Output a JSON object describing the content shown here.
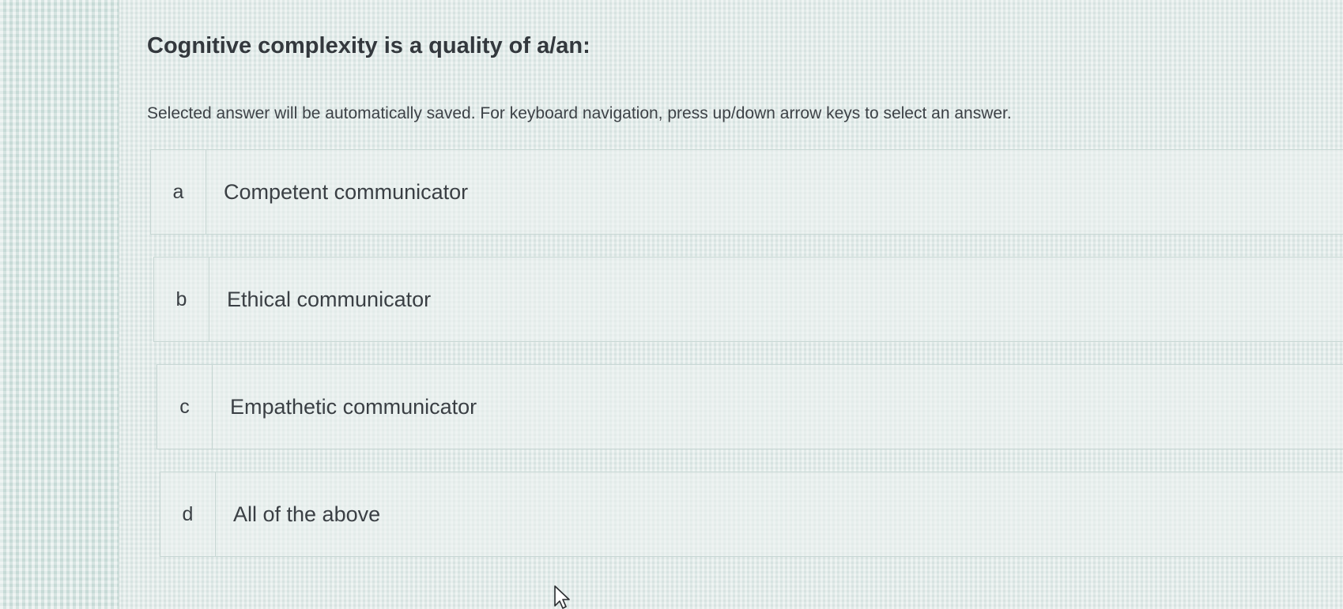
{
  "quiz": {
    "question": "Cognitive complexity is a quality of a/an:",
    "instructions": "Selected answer will be automatically saved. For keyboard navigation, press up/down arrow keys to select an answer.",
    "options": [
      {
        "letter": "a",
        "text": "Competent communicator"
      },
      {
        "letter": "b",
        "text": "Ethical communicator"
      },
      {
        "letter": "c",
        "text": "Empathetic communicator"
      },
      {
        "letter": "d",
        "text": "All of the above"
      }
    ]
  },
  "icons": {
    "cursor": "mouse-pointer-icon"
  },
  "colors": {
    "background": "#dfe8e6",
    "border": "#c8d7d4",
    "text": "#3a3f44"
  }
}
